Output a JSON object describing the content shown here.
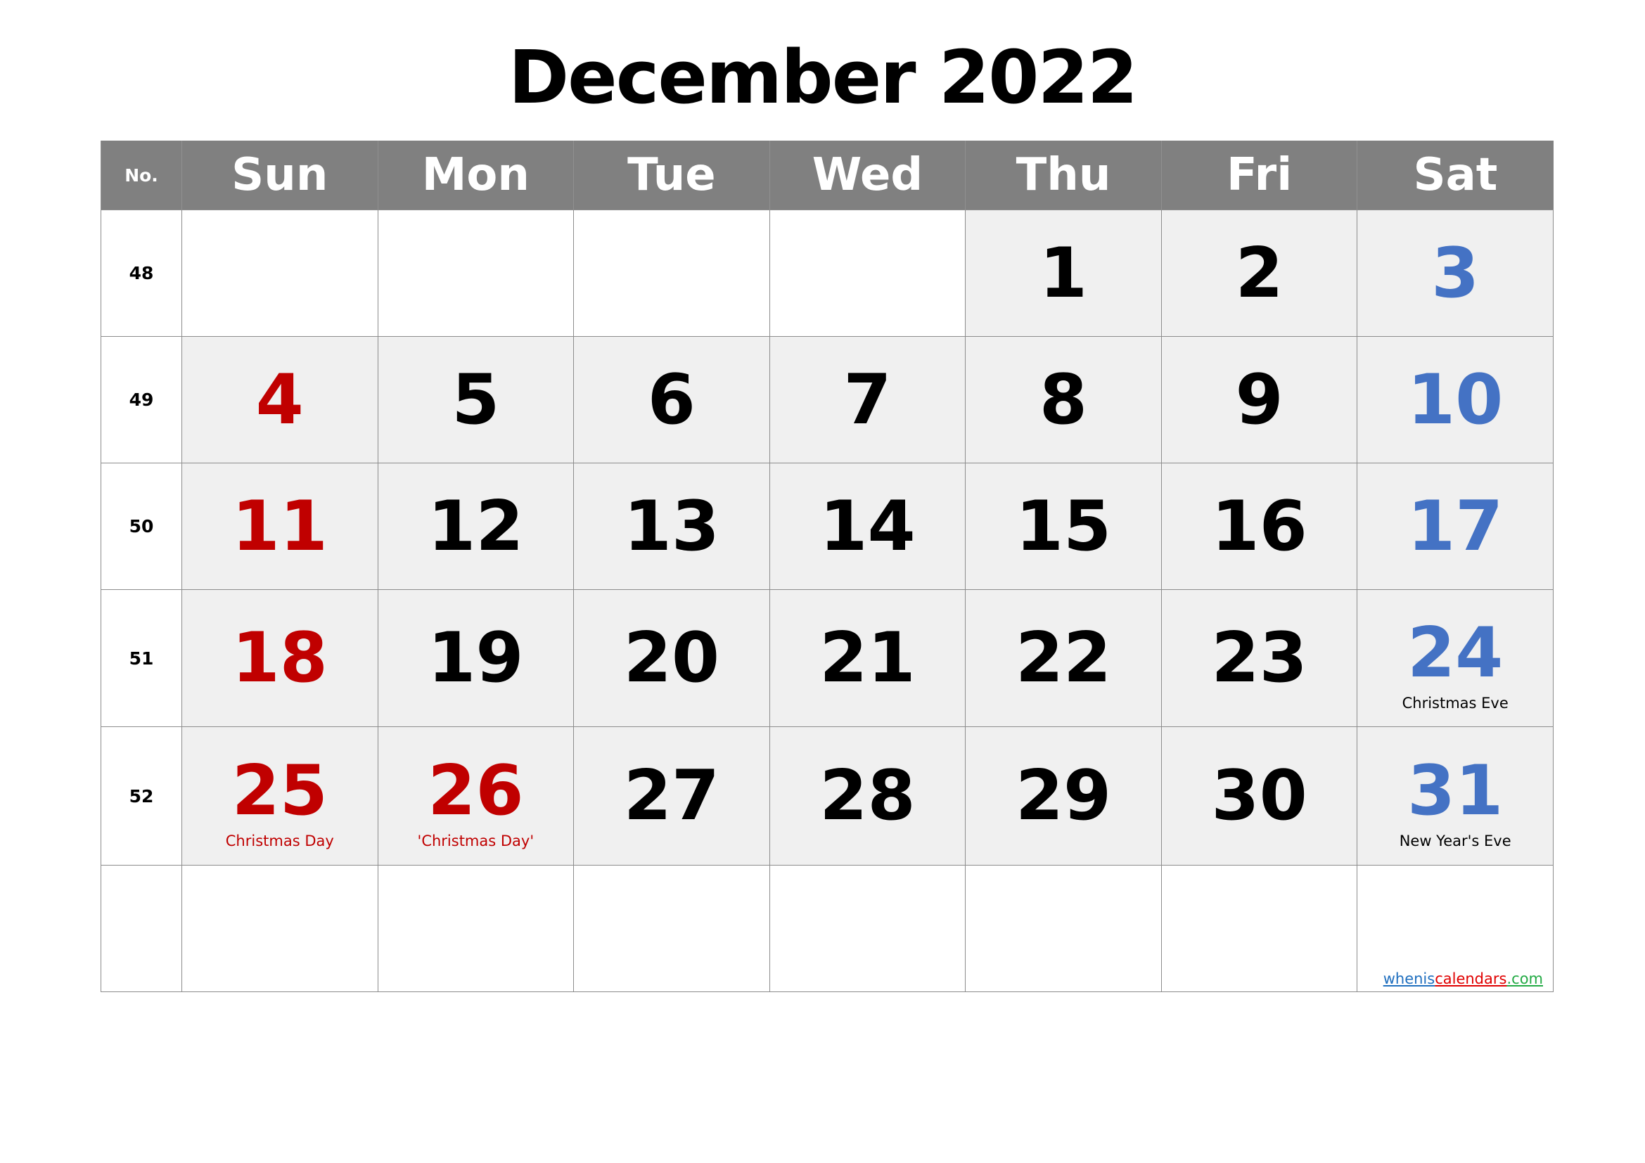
{
  "title": "December 2022",
  "header": {
    "week_label": "No.",
    "days": [
      "Sun",
      "Mon",
      "Tue",
      "Wed",
      "Thu",
      "Fri",
      "Sat"
    ]
  },
  "colors": {
    "header_bg": "#808080",
    "weekday": "#000000",
    "sunday_holiday": "#c00000",
    "saturday": "#4472c4",
    "shaded_cell": "#f0f0f0"
  },
  "weeks": [
    {
      "no": "48",
      "days": [
        {
          "n": "",
          "color": "none"
        },
        {
          "n": "",
          "color": "none"
        },
        {
          "n": "",
          "color": "none"
        },
        {
          "n": "",
          "color": "none"
        },
        {
          "n": "1",
          "color": "black"
        },
        {
          "n": "2",
          "color": "black"
        },
        {
          "n": "3",
          "color": "blue"
        }
      ]
    },
    {
      "no": "49",
      "days": [
        {
          "n": "4",
          "color": "red"
        },
        {
          "n": "5",
          "color": "black"
        },
        {
          "n": "6",
          "color": "black"
        },
        {
          "n": "7",
          "color": "black"
        },
        {
          "n": "8",
          "color": "black"
        },
        {
          "n": "9",
          "color": "black"
        },
        {
          "n": "10",
          "color": "blue"
        }
      ]
    },
    {
      "no": "50",
      "days": [
        {
          "n": "11",
          "color": "red"
        },
        {
          "n": "12",
          "color": "black"
        },
        {
          "n": "13",
          "color": "black"
        },
        {
          "n": "14",
          "color": "black"
        },
        {
          "n": "15",
          "color": "black"
        },
        {
          "n": "16",
          "color": "black"
        },
        {
          "n": "17",
          "color": "blue"
        }
      ]
    },
    {
      "no": "51",
      "days": [
        {
          "n": "18",
          "color": "red"
        },
        {
          "n": "19",
          "color": "black"
        },
        {
          "n": "20",
          "color": "black"
        },
        {
          "n": "21",
          "color": "black"
        },
        {
          "n": "22",
          "color": "black"
        },
        {
          "n": "23",
          "color": "black"
        },
        {
          "n": "24",
          "color": "blue",
          "note": "Christmas Eve",
          "note_color": "black"
        }
      ]
    },
    {
      "no": "52",
      "days": [
        {
          "n": "25",
          "color": "red",
          "note": "Christmas Day",
          "note_color": "red"
        },
        {
          "n": "26",
          "color": "red",
          "note": "'Christmas Day'",
          "note_color": "red"
        },
        {
          "n": "27",
          "color": "black"
        },
        {
          "n": "28",
          "color": "black"
        },
        {
          "n": "29",
          "color": "black"
        },
        {
          "n": "30",
          "color": "black"
        },
        {
          "n": "31",
          "color": "blue",
          "note": "New Year's Eve",
          "note_color": "black"
        }
      ]
    },
    {
      "no": "",
      "days": [
        {
          "n": "",
          "color": "none"
        },
        {
          "n": "",
          "color": "none"
        },
        {
          "n": "",
          "color": "none"
        },
        {
          "n": "",
          "color": "none"
        },
        {
          "n": "",
          "color": "none"
        },
        {
          "n": "",
          "color": "none"
        },
        {
          "n": "",
          "color": "none"
        }
      ]
    }
  ],
  "credit": {
    "part1": "whenis",
    "part2": "calendars",
    "part3": ".com"
  }
}
